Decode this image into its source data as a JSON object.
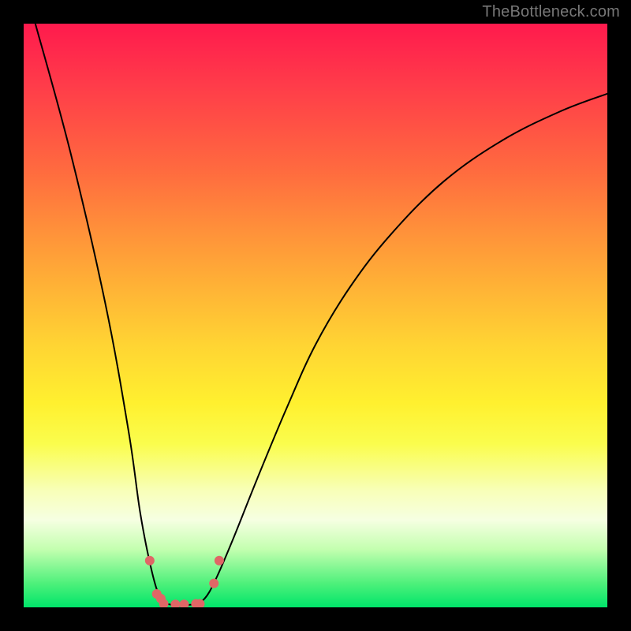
{
  "watermark": "TheBottleneck.com",
  "chart_data": {
    "type": "line",
    "title": "",
    "xlabel": "",
    "ylabel": "",
    "xlim": [
      0,
      100
    ],
    "ylim": [
      0,
      100
    ],
    "series": [
      {
        "name": "curve",
        "x": [
          2,
          8,
          14,
          18,
          20,
          22,
          23.5,
          25,
          27,
          29,
          31,
          33,
          36,
          40,
          45,
          50,
          56,
          63,
          72,
          82,
          92,
          100
        ],
        "values": [
          100,
          78,
          52,
          30,
          16,
          6,
          1.5,
          0.5,
          0.5,
          0.5,
          1.5,
          5,
          12,
          22,
          34,
          45,
          55,
          64,
          73,
          80,
          85,
          88
        ]
      }
    ],
    "markers": [
      {
        "x": 21.6,
        "y": 8.0
      },
      {
        "x": 22.8,
        "y": 2.3
      },
      {
        "x": 23.5,
        "y": 1.5
      },
      {
        "x": 24.0,
        "y": 0.6
      },
      {
        "x": 26.0,
        "y": 0.5
      },
      {
        "x": 27.5,
        "y": 0.5
      },
      {
        "x": 29.5,
        "y": 0.6
      },
      {
        "x": 30.2,
        "y": 0.6
      },
      {
        "x": 32.6,
        "y": 4.1
      },
      {
        "x": 33.5,
        "y": 8.0
      }
    ]
  },
  "marker_style": {
    "color": "#e06666",
    "radius": 6
  }
}
